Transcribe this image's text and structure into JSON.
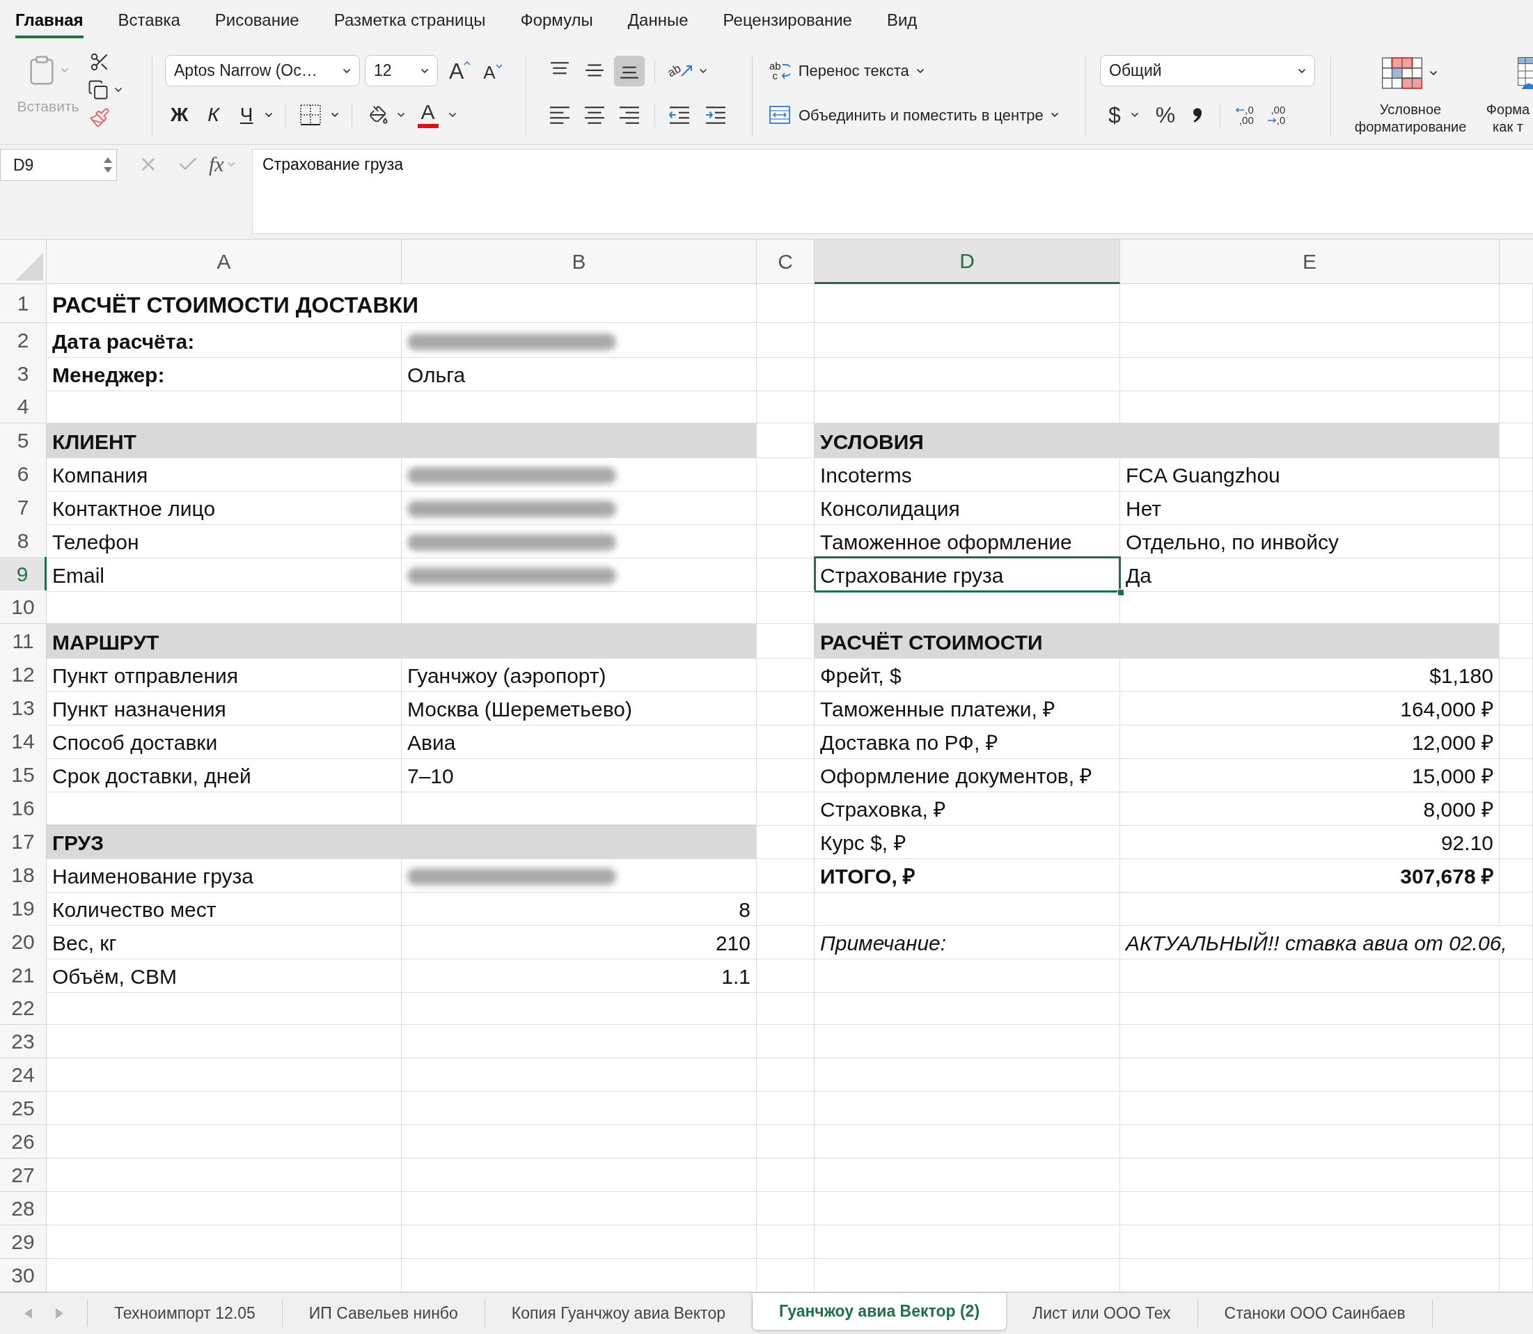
{
  "ribbon_tabs": [
    {
      "label": "Главная",
      "selected": true
    },
    {
      "label": "Вставка",
      "selected": false
    },
    {
      "label": "Рисование",
      "selected": false
    },
    {
      "label": "Разметка страницы",
      "selected": false
    },
    {
      "label": "Формулы",
      "selected": false
    },
    {
      "label": "Данные",
      "selected": false
    },
    {
      "label": "Рецензирование",
      "selected": false
    },
    {
      "label": "Вид",
      "selected": false
    }
  ],
  "clipboard": {
    "paste_label": "Вставить",
    "paste_disabled": true
  },
  "font": {
    "name": "Aptos Narrow (Oc…",
    "size": "12",
    "grow": "A",
    "shrink": "A",
    "bold": "Ж",
    "italic": "К",
    "underline": "Ч",
    "font_color_letter": "A"
  },
  "alignment": {
    "vertical": [
      {
        "kind": "top",
        "selected": false
      },
      {
        "kind": "middle",
        "selected": false
      },
      {
        "kind": "bottom",
        "selected": true
      }
    ],
    "orientation_letters": "ab",
    "horizontal": [
      {
        "kind": "left",
        "selected": false
      },
      {
        "kind": "center",
        "selected": false
      },
      {
        "kind": "right",
        "selected": false
      }
    ]
  },
  "wrap_text": {
    "letters": [
      "ab",
      "c"
    ],
    "label": "Перенос текста"
  },
  "merge": {
    "label": "Объединить и поместить в центре"
  },
  "number_format": {
    "value": "Общий",
    "currency": "$",
    "percent": "%",
    "add_decimal": [
      ",0",
      ",00"
    ],
    "remove_decimal": [
      ",00",
      ",0"
    ]
  },
  "styles": [
    {
      "kind": "conditional",
      "lines": [
        "Условное",
        "форматирование"
      ]
    },
    {
      "kind": "table",
      "lines": [
        "Форма",
        "как т"
      ]
    }
  ],
  "formula_bar": {
    "name_box": "D9",
    "function_label": "fx",
    "content": "Страхование груза"
  },
  "columns": [
    {
      "label": "A",
      "selected": false
    },
    {
      "label": "B",
      "selected": false
    },
    {
      "label": "C",
      "selected": false
    },
    {
      "label": "D",
      "selected": true
    },
    {
      "label": "E",
      "selected": false
    }
  ],
  "rows": [
    {
      "number": "1",
      "selected": false,
      "a": {
        "kind": "title",
        "text": "РАСЧЁТ СТОИМОСТИ ДОСТАВКИ"
      }
    },
    {
      "number": "2",
      "selected": false,
      "a": {
        "kind": "bold",
        "text": "Дата расчёта:"
      },
      "b": {
        "kind": "redacted"
      }
    },
    {
      "number": "3",
      "selected": false,
      "a": {
        "kind": "bold",
        "text": "Менеджер:"
      },
      "b": {
        "kind": "text",
        "text": "Ольга"
      }
    },
    {
      "number": "4",
      "selected": false
    },
    {
      "number": "5",
      "selected": false,
      "a": {
        "kind": "section",
        "text": "КЛИЕНТ"
      },
      "d": {
        "kind": "section",
        "text": "УСЛОВИЯ"
      }
    },
    {
      "number": "6",
      "selected": false,
      "a": {
        "kind": "text",
        "text": "Компания"
      },
      "b": {
        "kind": "redacted"
      },
      "d": {
        "kind": "text",
        "text": "Incoterms"
      },
      "e": {
        "kind": "text",
        "text": "FCA Guangzhou"
      }
    },
    {
      "number": "7",
      "selected": false,
      "a": {
        "kind": "text",
        "text": "Контактное лицо"
      },
      "b": {
        "kind": "redacted"
      },
      "d": {
        "kind": "text",
        "text": "Консолидация"
      },
      "e": {
        "kind": "text",
        "text": "Нет"
      }
    },
    {
      "number": "8",
      "selected": false,
      "a": {
        "kind": "text",
        "text": "Телефон"
      },
      "b": {
        "kind": "redacted"
      },
      "d": {
        "kind": "text",
        "text": "Таможенное оформление"
      },
      "e": {
        "kind": "text",
        "text": "Отдельно, по инвойсу"
      }
    },
    {
      "number": "9",
      "selected": true,
      "a": {
        "kind": "text",
        "text": "Email"
      },
      "b": {
        "kind": "redacted"
      },
      "d": {
        "kind": "text",
        "text": "Страхование груза"
      },
      "e": {
        "kind": "text",
        "text": "Да"
      }
    },
    {
      "number": "10",
      "selected": false
    },
    {
      "number": "11",
      "selected": false,
      "a": {
        "kind": "section",
        "text": "МАРШРУТ"
      },
      "d": {
        "kind": "section",
        "text": "РАСЧЁТ СТОИМОСТИ"
      }
    },
    {
      "number": "12",
      "selected": false,
      "a": {
        "kind": "text",
        "text": "Пункт отправления"
      },
      "b": {
        "kind": "text",
        "text": "Гуанчжоу (аэропорт)"
      },
      "d": {
        "kind": "text",
        "text": "Фрейт, $"
      },
      "e": {
        "kind": "number",
        "text": "$1,180"
      }
    },
    {
      "number": "13",
      "selected": false,
      "a": {
        "kind": "text",
        "text": "Пункт назначения"
      },
      "b": {
        "kind": "text",
        "text": "Москва (Шереметьево)"
      },
      "d": {
        "kind": "text",
        "text": "Таможенные платежи, ₽"
      },
      "e": {
        "kind": "number",
        "text": "164,000 ₽"
      }
    },
    {
      "number": "14",
      "selected": false,
      "a": {
        "kind": "text",
        "text": "Способ доставки"
      },
      "b": {
        "kind": "text",
        "text": "Авиа"
      },
      "d": {
        "kind": "text",
        "text": "Доставка по РФ, ₽"
      },
      "e": {
        "kind": "number",
        "text": "12,000 ₽"
      }
    },
    {
      "number": "15",
      "selected": false,
      "a": {
        "kind": "text",
        "text": "Срок доставки, дней"
      },
      "b": {
        "kind": "text",
        "text": "7–10"
      },
      "d": {
        "kind": "text",
        "text": "Оформление документов, ₽"
      },
      "e": {
        "kind": "number",
        "text": "15,000 ₽"
      }
    },
    {
      "number": "16",
      "selected": false,
      "d": {
        "kind": "text",
        "text": "Страховка, ₽"
      },
      "e": {
        "kind": "number",
        "text": "8,000 ₽"
      }
    },
    {
      "number": "17",
      "selected": false,
      "a": {
        "kind": "section",
        "text": "ГРУЗ"
      },
      "d": {
        "kind": "text",
        "text": "Курс $, ₽"
      },
      "e": {
        "kind": "number",
        "text": "92.10"
      }
    },
    {
      "number": "18",
      "selected": false,
      "a": {
        "kind": "text",
        "text": "Наименование груза"
      },
      "b": {
        "kind": "redacted"
      },
      "d": {
        "kind": "bold",
        "text": "ИТОГО, ₽"
      },
      "e": {
        "kind": "total",
        "text": "307,678 ₽"
      }
    },
    {
      "number": "19",
      "selected": false,
      "a": {
        "kind": "text",
        "text": "Количество мест"
      },
      "b": {
        "kind": "number",
        "text": "8"
      }
    },
    {
      "number": "20",
      "selected": false,
      "a": {
        "kind": "text",
        "text": "Вес, кг"
      },
      "b": {
        "kind": "number",
        "text": "210"
      },
      "d": {
        "kind": "note",
        "text": "Примечание:"
      },
      "e": {
        "kind": "note",
        "text": "АКТУАЛЬНЫЙ!! ставка авиа от 02.06,"
      }
    },
    {
      "number": "21",
      "selected": false,
      "a": {
        "kind": "text",
        "text": "Объём, CBM"
      },
      "b": {
        "kind": "number",
        "text": "1.1"
      }
    },
    {
      "number": "22",
      "selected": false
    },
    {
      "number": "23",
      "selected": false
    },
    {
      "number": "24",
      "selected": false
    },
    {
      "number": "25",
      "selected": false
    },
    {
      "number": "26",
      "selected": false
    },
    {
      "number": "27",
      "selected": false
    },
    {
      "number": "28",
      "selected": false
    },
    {
      "number": "29",
      "selected": false
    },
    {
      "number": "30",
      "selected": false
    }
  ],
  "sheet_tabs": [
    {
      "label": "Техноимпорт 12.05",
      "selected": false
    },
    {
      "label": "ИП Савельев нинбо",
      "selected": false
    },
    {
      "label": "Копия Гуанчжоу авиа Вектор",
      "selected": false
    },
    {
      "label": "Гуанчжоу авиа Вектор (2)",
      "selected": true
    },
    {
      "label": "Лист или ООО Тех",
      "selected": false
    },
    {
      "label": "Станоки ООО Саинбаев",
      "selected": false
    }
  ]
}
